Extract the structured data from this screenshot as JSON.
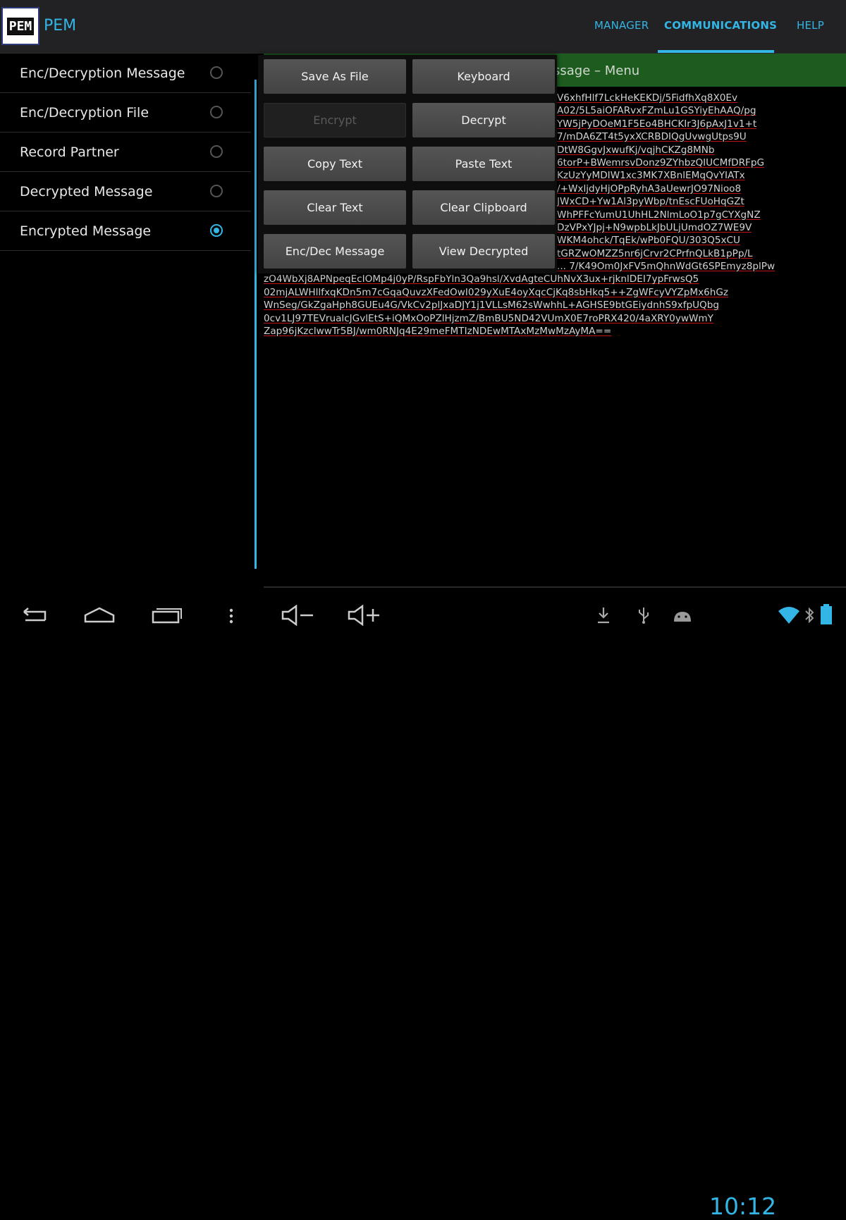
{
  "app": {
    "logo_text": "PEM",
    "title": "PEM"
  },
  "tabs": [
    {
      "label": "MANAGER"
    },
    {
      "label": "COMMUNICATIONS",
      "selected": true
    },
    {
      "label": "HELP"
    }
  ],
  "sidebar": {
    "items": [
      {
        "label": "Enc/Decryption Message",
        "checked": false
      },
      {
        "label": "Enc/Decryption File",
        "checked": false
      },
      {
        "label": "Record Partner",
        "checked": false
      },
      {
        "label": "Decrypted Message",
        "checked": false
      },
      {
        "label": "Encrypted Message",
        "checked": true
      }
    ]
  },
  "content": {
    "header_partial": "ssage – Menu",
    "cipher_lines": [
      "V6xhfHlf7LckHeKEKDj/5FidfhXq8X0Ev",
      "A02/5L5aiOFARvxFZmLu1GSYiyEhAAQ/pg",
      "YW5jPyDOeM1F5Eo4BHCKIr3J6pAxJ1v1+t",
      "7/mDA6ZT4t5yxXCRBDIQgUvwgUtps9U",
      "DtW8GgvJxwufKj/vqjhCKZg8MNb",
      "6torP+BWemrsvDonz9ZYhbzQIUCMfDRFpG",
      "KzUzYyMDIW1xc3MK7XBnlEMqQvYIATx",
      "/+WxljdyHjOPpRyhA3aUewrJO97Nioo8",
      "JWxCD+Yw1Al3pyWbp/tnEscFUoHqGZt",
      "WhPFFcYumU1UhHL2NlmLoO1p7gCYXgNZ",
      "DzVPxYJpj+N9wpbLkJbULjUmdOZ7WE9V",
      "WKM4ohck/TqEk/wPb0FQU/303Q5xCU",
      "tGRZwOMZZ5nr6jCrvr2CPrfnQLkB1pPp/L",
      "...    7/K49Om0JxFV5mQhnWdGt6SPEmyz8plPw",
      "zO4WbXj8APNpeqEcIOMp4j0yP/RspFbYln3Qa9hsl/XvdAgteCUhNvX3ux+rjknlDEI7ypFrwsQ5",
      "02mjALWHllfxqKDn5m7cGqaQuvzXFedOwI029yXuE4oyXqcCjKq8sbHkq5++ZgWFcyVYZpMx6hGz",
      "WnSeg/GkZgaHph8GUEu4G/VkCv2plJxaDJY1j1VLLsM62sWwhhL+AGHSE9btGEiydnhS9xfpUQbg",
      "0cv1LJ97TEVrualcJGvlEtS+iQMxOoPZlHjzmZ/BmBU5ND42VUmX0E7roPRX420/4aXRY0ywWmY",
      "Zap96jKzclwwTr5BJ/wm0RNJq4E29meFMTIzNDEwMTAxMzMwMzAyMA=="
    ]
  },
  "popup": {
    "buttons": [
      {
        "label": "Save As File",
        "enabled": true
      },
      {
        "label": "Keyboard",
        "enabled": true
      },
      {
        "label": "Encrypt",
        "enabled": false
      },
      {
        "label": "Decrypt",
        "enabled": true
      },
      {
        "label": "Copy Text",
        "enabled": true
      },
      {
        "label": "Paste Text",
        "enabled": true
      },
      {
        "label": "Clear Text",
        "enabled": true
      },
      {
        "label": "Clear Clipboard",
        "enabled": true
      },
      {
        "label": "Enc/Dec Message",
        "enabled": true
      },
      {
        "label": "View Decrypted",
        "enabled": true
      }
    ]
  },
  "statusbar": {
    "time": "10:12"
  },
  "colors": {
    "accent": "#33b5e5",
    "header_green": "#1d5c1e",
    "underline_red": "#c01414"
  },
  "icons": [
    "back-icon",
    "home-icon",
    "recent-apps-icon",
    "overflow-menu-icon",
    "volume-down-icon",
    "volume-up-icon",
    "download-icon",
    "usb-icon",
    "android-debug-icon",
    "wifi-icon",
    "bluetooth-icon",
    "battery-icon"
  ]
}
